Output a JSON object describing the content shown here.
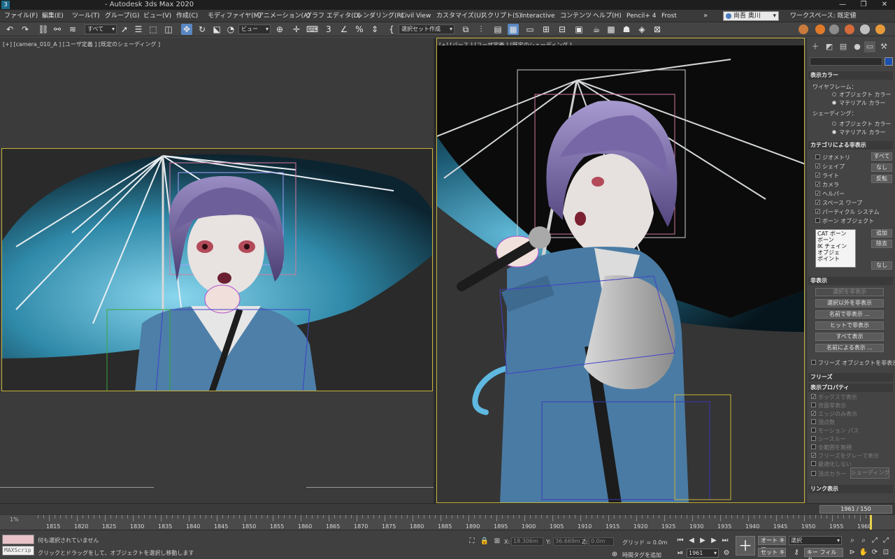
{
  "titlebar": {
    "title": "- Autodesk 3ds Max 2020",
    "app_icon": "3",
    "minimize": "—",
    "maximize": "❐",
    "close": "✕"
  },
  "menu": {
    "items": [
      "ファイル(F)",
      "編集(E)",
      "ツール(T)",
      "グループ(G)",
      "ビュー(V)",
      "作成(C)",
      "モディファイヤ(M)",
      "アニメーション(A)",
      "グラフ エディタ(D)",
      "レンダリング(R)",
      "Civil View",
      "カスタマイズ(U)",
      "スクリプト(S)",
      "Interactive",
      "コンテンツ",
      "ヘルプ(H)",
      "Pencil+ 4",
      "Frost"
    ],
    "more": "»",
    "user": "尚吾 奥川",
    "workspace": "ワークスペース: 既定値"
  },
  "toolbar": {
    "selection_filter": "すべて",
    "ref_coord": "ビュー",
    "named_selection": "選択セット作成",
    "icons": [
      "undo-icon",
      "redo-icon",
      "link-icon",
      "unlink-icon",
      "bind-spacewarp-icon",
      "select-icon",
      "select-by-name-icon",
      "rect-select-icon",
      "window-crossing-icon",
      "move-icon",
      "rotate-icon",
      "scale-icon",
      "pivot-icon",
      "snap-icon",
      "angle-snap-icon",
      "percent-snap-icon",
      "spinner-snap-icon",
      "mirror-icon",
      "align-icon"
    ]
  },
  "viewports": {
    "left_label": "[+] [camera_010_A ] [ユーザ定義 ] [既定のシェーディング ]",
    "right_label": "[+] [パース ] [ユーザ定義 ] [既定のシェーディング ]"
  },
  "panel": {
    "display_color": {
      "header": "表示カラー",
      "wireframe_label": "ワイヤフレーム：",
      "wire_options": [
        "オブジェクト カラー",
        "マテリアル カラー"
      ],
      "shading_label": "シェーディング：",
      "shade_options": [
        "オブジェクト カラー",
        "マテリアル カラー"
      ]
    },
    "hide_by_category": {
      "header": "カテゴリによる非表示",
      "items": [
        "ジオメトリ",
        "シェイプ",
        "ライト",
        "カメラ",
        "ヘルパー",
        "スペース ワープ",
        "パーティクル システム",
        "ボーン オブジェクト"
      ],
      "buttons": [
        "すべて",
        "なし",
        "反転"
      ],
      "list": [
        "CAT ボーン",
        "ボーン",
        "IK チェイン オブジェ",
        "ポイント"
      ],
      "add": "追加",
      "remove": "除去",
      "none": "なし"
    },
    "hide": {
      "header": "非表示",
      "buttons": [
        "選択を非表示",
        "選択以外を非表示",
        "名前で非表示 ...",
        "ヒットで非表示",
        "すべて表示",
        "名前による表示 ..."
      ],
      "freeze_check": "フリーズ オブジェクトを非表示"
    },
    "freeze": {
      "header": "フリーズ"
    },
    "display_props": {
      "header": "表示プロパティ",
      "items": [
        "ボックスで表示",
        "背面非表示",
        "エッジのみ表示",
        "頂点数",
        "モーション パス",
        "シースルー",
        "全範囲を無視",
        "フリーズをグレーで表示",
        "最適化しない",
        "頂点カラー"
      ],
      "shading_btn": "シェーディング"
    },
    "link_display": {
      "header": "リンク表示"
    }
  },
  "timeline": {
    "slider": "1961 / 150",
    "percent": "1%",
    "ticks": [
      "1815",
      "1820",
      "1825",
      "1830",
      "1835",
      "1840",
      "1845",
      "1850",
      "1855",
      "1860",
      "1865",
      "1870",
      "1875",
      "1880",
      "1885",
      "1890",
      "1895",
      "1900",
      "1905",
      "1910",
      "1915",
      "1920",
      "1925",
      "1930",
      "1935",
      "1940",
      "1945",
      "1950",
      "1955",
      "1960"
    ]
  },
  "status": {
    "maxscript": "MAXScrip",
    "msg1": "何も選択されていません",
    "msg2": "クリックとドラッグをして、オブジェクトを選択し移動します",
    "x_label": "X:",
    "x_value": "18.306m",
    "y_label": "Y:",
    "y_value": "36.669m",
    "z_label": "Z:",
    "z_value": "0.0m",
    "grid": "グリッド = 0.0m",
    "add_time_tag": "時間タグを追加",
    "frame": "1961",
    "auto_key": "オート キー",
    "set_key": "セット キー",
    "key_mode": "選択",
    "key_filter": "キー フィルタ..."
  },
  "colors": {
    "accent": "#5a88c2",
    "frame": "#c8b43a",
    "umbrella": "#3c96b4",
    "hair": "#7c6ea8",
    "jacket": "#4d7fa8"
  }
}
